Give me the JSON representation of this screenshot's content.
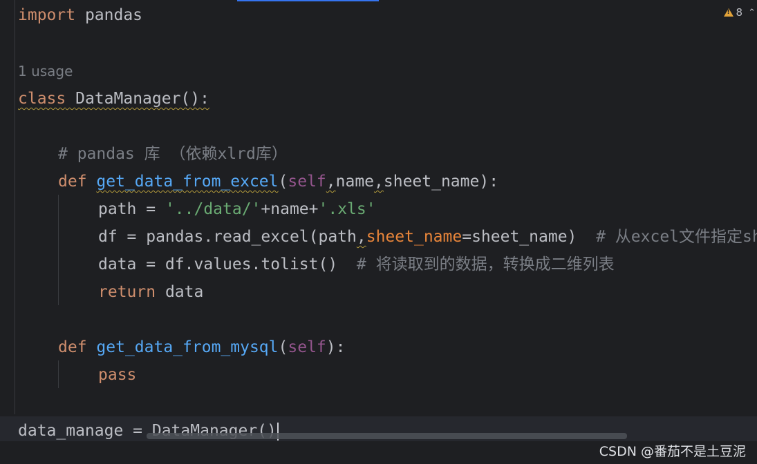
{
  "inspection": {
    "warning_count": "8",
    "warning_icon": "warning-triangle-icon",
    "chevron_icon": "chevron-up-icon"
  },
  "code": {
    "l1_kw": "import",
    "l1_mod": " pandas",
    "usage_hint": "1 usage",
    "l3_kw": "class",
    "l3_name": "DataManager():",
    "l4_comment": "# pandas 库 （依赖xlrd库）",
    "l5_def": "def",
    "l5_fn": "get_data_from_excel",
    "l5_open": "(",
    "l5_self": "self",
    "l5_c1": ",",
    "l5_name": "name",
    "l5_c2": ",",
    "l5_rest": "sheet_name):",
    "l6_a": "path = ",
    "l6_s1": "'../data/'",
    "l6_b": "+name+",
    "l6_s2": "'.xls'",
    "l7_a": "df = pandas.read_excel(path",
    "l7_comma": ",",
    "l7_param": "sheet_name",
    "l7_b": "=sheet_name)  ",
    "l7_comment": "# 从excel文件指定sheet中读取数据",
    "l8_a": "data = df.values.tolist()  ",
    "l8_comment": "# 将读取到的数据，转换成二维列表",
    "l9_kw": "return",
    "l9_rest": " data",
    "l11_def": "def",
    "l11_fn": "get_data_from_mysql",
    "l11_open": "(",
    "l11_self": "self",
    "l11_close": "):",
    "l12_kw": "pass",
    "l14": "data_manage = DataManager()"
  },
  "watermark": "CSDN @番茄不是土豆泥",
  "colors": {
    "background": "#1e1f22",
    "keyword": "#cf8e6d",
    "function": "#56a8f5",
    "self": "#94558d",
    "string": "#6aab73",
    "named_param": "#e8853a",
    "comment": "#7a7e85"
  }
}
